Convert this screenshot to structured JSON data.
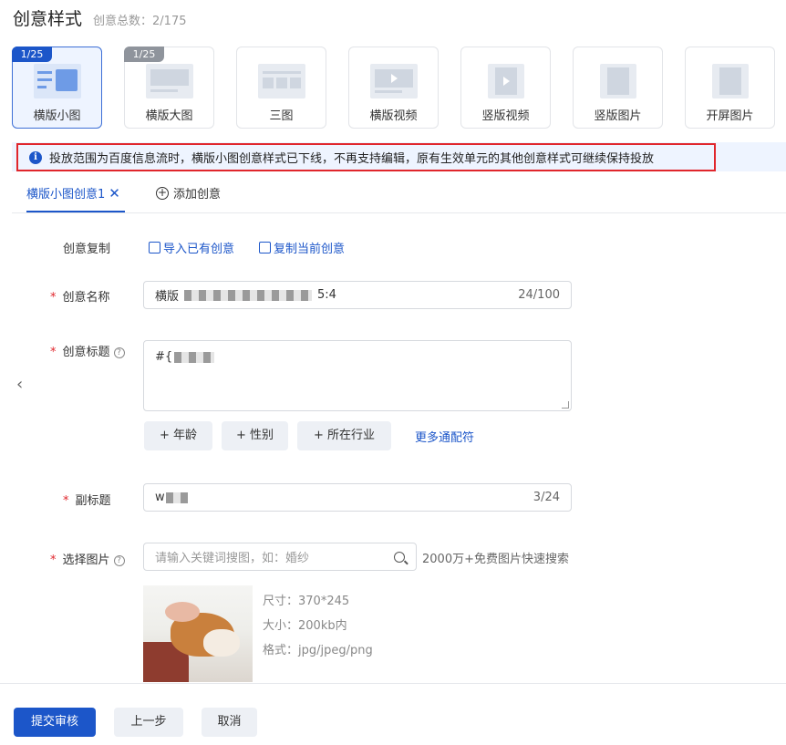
{
  "header": {
    "title": "创意样式",
    "count": "创意总数：2/175"
  },
  "styles": [
    {
      "label": "横版小图",
      "badge": "1/25",
      "active": true
    },
    {
      "label": "横版大图",
      "badge": "1/25"
    },
    {
      "label": "三图"
    },
    {
      "label": "横版视频"
    },
    {
      "label": "竖版视频"
    },
    {
      "label": "竖版图片"
    },
    {
      "label": "开屏图片"
    }
  ],
  "notice": {
    "icon": "info-icon",
    "text": "投放范围为百度信息流时，横版小图创意样式已下线，不再支持编辑，原有生效单元的其他创意样式可继续保持投放"
  },
  "tabs": {
    "active": "横版小图创意1",
    "close": "✕",
    "add": "添加创意"
  },
  "form": {
    "copy_label": "创意复制",
    "import_link": "导入已有创意",
    "copy_link": "复制当前创意",
    "name_label": "创意名称",
    "name_prefix": "横版",
    "name_suffix": "5:4",
    "name_counter": "24/100",
    "title_label": "创意标题",
    "title_value": "#{",
    "chips": [
      "+ 年龄",
      "+ 性别",
      "+ 所在行业"
    ],
    "more_wildcards": "更多通配符",
    "subtitle_label": "副标题",
    "subtitle_value": "w",
    "subtitle_counter": "3/24",
    "image_label": "选择图片",
    "search_placeholder": "请输入关键词搜图，如：婚纱",
    "search_tip": "2000万+免费图片快速搜索",
    "spec_size": "尺寸：370*245",
    "spec_filesize": "大小：200kb内",
    "spec_format": "格式：jpg/jpeg/png"
  },
  "footer": {
    "submit": "提交审核",
    "prev": "上一步",
    "cancel": "取消"
  },
  "colors": {
    "primary": "#1c56c9",
    "required": "#e0262c",
    "notice_bg": "#eef4ff"
  }
}
